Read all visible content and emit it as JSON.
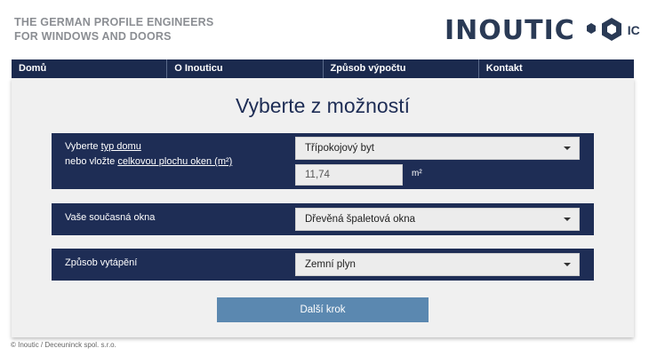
{
  "header": {
    "tagline_line1": "THE GERMAN PROFILE ENGINEERS",
    "tagline_line2": "FOR WINDOWS AND DOORS",
    "logo_text": "INOUTIC",
    "logo_badge": "IC"
  },
  "nav": {
    "items": [
      {
        "label": "Domů"
      },
      {
        "label": "O Inouticu"
      },
      {
        "label": "Způsob výpočtu"
      },
      {
        "label": "Kontakt"
      }
    ]
  },
  "main": {
    "title": "Vyberte z možností",
    "house": {
      "text1": "Vyberte ",
      "link_type": "typ domu",
      "text2": "nebo vložte ",
      "link_area": "celkovou plochu oken (m²)",
      "select_value": "Třípokojový byt",
      "area_value": "11,74",
      "unit": "m²"
    },
    "windows": {
      "label": "Vaše současná okna",
      "select_value": "Dřevěná špaletová okna"
    },
    "heating": {
      "label": "Způsob vytápění",
      "select_value": "Zemní plyn"
    },
    "next_button": "Další krok"
  },
  "footer": {
    "text": "© Inoutic / Deceuninck spol. s.r.o."
  },
  "colors": {
    "brand_navy": "#1e2d55",
    "nav_bg": "#1b2a4e",
    "button": "#5b88b0"
  }
}
